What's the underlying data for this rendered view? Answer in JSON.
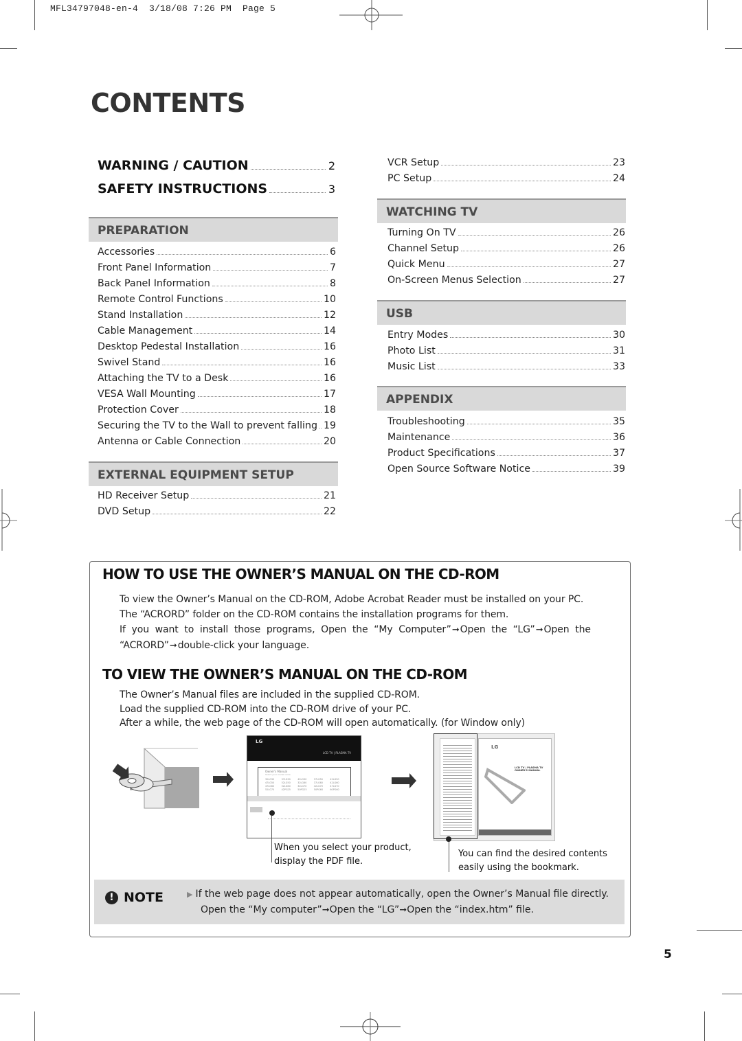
{
  "print_header": "MFL34797048-en-4  3/18/08 7:26 PM  Page 5",
  "title": "CONTENTS",
  "major": [
    {
      "label": "WARNING / CAUTION",
      "page": "2"
    },
    {
      "label": "SAFETY INSTRUCTIONS",
      "page": "3"
    }
  ],
  "sections": {
    "preparation": {
      "title": "PREPARATION",
      "items": [
        {
          "label": "Accessories",
          "page": "6"
        },
        {
          "label": "Front Panel Information",
          "page": "7"
        },
        {
          "label": "Back Panel Information",
          "page": "8"
        },
        {
          "label": "Remote Control Functions",
          "page": "10"
        },
        {
          "label": "Stand Installation",
          "page": "12"
        },
        {
          "label": "Cable Management",
          "page": "14"
        },
        {
          "label": "Desktop Pedestal Installation",
          "page": "16"
        },
        {
          "label": "Swivel Stand",
          "page": "16"
        },
        {
          "label": "Attaching the TV to a Desk",
          "page": "16"
        },
        {
          "label": "VESA Wall Mounting",
          "page": "17"
        },
        {
          "label": "Protection Cover",
          "page": "18"
        },
        {
          "label": "Securing the TV to the Wall to prevent falling",
          "page": "19"
        },
        {
          "label": "Antenna or Cable Connection",
          "page": "20"
        }
      ]
    },
    "external": {
      "title": "EXTERNAL EQUIPMENT SETUP",
      "items": [
        {
          "label": "HD Receiver Setup",
          "page": "21"
        },
        {
          "label": "DVD Setup",
          "page": "22"
        },
        {
          "label": "VCR Setup",
          "page": "23"
        },
        {
          "label": "PC Setup",
          "page": "24"
        }
      ]
    },
    "watching": {
      "title": "WATCHING TV",
      "items": [
        {
          "label": "Turning On TV",
          "page": "26"
        },
        {
          "label": "Channel Setup",
          "page": "26"
        },
        {
          "label": "Quick Menu",
          "page": "27"
        },
        {
          "label": "On-Screen Menus Selection",
          "page": "27"
        }
      ]
    },
    "usb": {
      "title": "USB",
      "items": [
        {
          "label": "Entry Modes",
          "page": "30"
        },
        {
          "label": "Photo List",
          "page": "31"
        },
        {
          "label": "Music List",
          "page": "33"
        }
      ]
    },
    "appendix": {
      "title": "APPENDIX",
      "items": [
        {
          "label": "Troubleshooting",
          "page": "35"
        },
        {
          "label": "Maintenance",
          "page": "36"
        },
        {
          "label": "Product Specifications",
          "page": "37"
        },
        {
          "label": "Open Source Software Notice",
          "page": "39"
        }
      ]
    }
  },
  "cdrom": {
    "how_title": "HOW TO USE THE OWNER’S MANUAL ON THE CD-ROM",
    "how_lines": [
      "To view the Owner’s Manual on the CD-ROM, Adobe Acrobat Reader must be installed on your PC.",
      "The “ACRORD” folder on the CD-ROM contains the installation programs for them."
    ],
    "how_steps_line1": [
      "If  you  want  to  install  those  programs,  Open  the  “My  Computer”",
      "Open  the  “LG”",
      "Open  the"
    ],
    "how_steps_line2": [
      "“ACRORD”",
      "double-click your language."
    ],
    "view_title": "TO VIEW THE OWNER’S MANUAL ON THE CD-ROM",
    "view_lines": [
      "The Owner’s Manual files are included in the supplied CD-ROM.",
      "Load the supplied CD-ROM into the CD-ROM drive of your PC.",
      "After a while, the web page of the CD-ROM will open automatically. (for Window only)"
    ],
    "caption1": [
      "When you select your product,",
      "display the PDF file."
    ],
    "caption2": [
      "You can find the desired contents",
      "easily using the bookmark."
    ],
    "screen1": {
      "brand": "LG",
      "tabs": "LCD TV  |  PLASMA TV",
      "box_title": "Owner's Manual",
      "box_sub": "Select your model name",
      "models": [
        "32LG30",
        "37LG30",
        "42LG30",
        "37LG50",
        "42LG50",
        "47LG50",
        "52LG50",
        "32LG60",
        "37LG60",
        "42LG60",
        "47LG60",
        "52LG60",
        "32LG70",
        "42LG70",
        "47LG70",
        "52LG70",
        "42PG25",
        "50PG25",
        "50PG60",
        "60PG60"
      ]
    },
    "screen2": {
      "brand": "LG",
      "cover_title_1": "LCD TV  |  PLASMA TV",
      "cover_title_2": "OWNER'S MANUAL"
    },
    "note": {
      "label": "NOTE",
      "line1": "If the web page does not appear automatically, open the Owner’s Manual file directly.",
      "line2": [
        "Open the “My computer”",
        "Open the “LG”",
        "Open the “index.htm” file."
      ]
    }
  },
  "arrow_glyph": "➞",
  "page_number": "5"
}
